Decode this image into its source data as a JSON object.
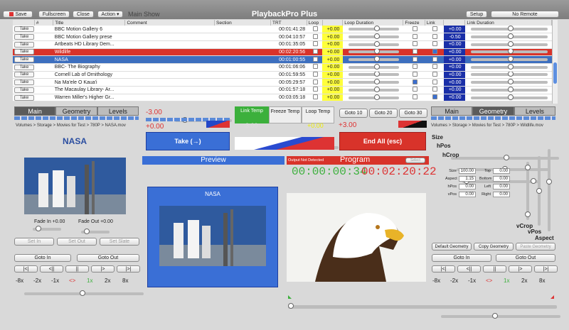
{
  "toolbar": {
    "save": "Save",
    "fullscreen": "Fullscreen",
    "close": "Close",
    "action": "Action",
    "show": "Main Show",
    "app": "PlaybackPro Plus",
    "setup": "Setup",
    "remote": "No Remote"
  },
  "table": {
    "headers": [
      "",
      "#",
      "Title",
      "Comment",
      "Section",
      "TRT",
      "Loop",
      "",
      "Loop Duration",
      "Freeze",
      "Link",
      "",
      "Link Duration"
    ],
    "take": "Take",
    "rows": [
      {
        "title": "BBC Motion Gallery 6",
        "trt": "00:01:41:28",
        "loop": "+0.00",
        "freeze": false,
        "link": false,
        "link_dur": "+0.00",
        "state": ""
      },
      {
        "title": "BBC Motion Gallery prese",
        "trt": "00:04:10:57",
        "loop": "+0.00",
        "freeze": false,
        "link": false,
        "link_dur": "-0.50",
        "state": ""
      },
      {
        "title": "Artbeats HD Library Dem...",
        "trt": "00:01:35:05",
        "loop": "+0.00",
        "freeze": false,
        "link": false,
        "link_dur": "+0.00",
        "state": ""
      },
      {
        "title": "Wildlife",
        "trt": "00:02:20:56",
        "loop": "+0.00",
        "freeze": false,
        "link": true,
        "link_dur": "+0.00",
        "state": "red"
      },
      {
        "title": "NASA",
        "trt": "00:01:00:55",
        "loop": "+0.00",
        "freeze": false,
        "link": false,
        "link_dur": "+0.00",
        "state": "blue"
      },
      {
        "title": "BBC- The Biography",
        "trt": "00:01:06:06",
        "loop": "+0.00",
        "freeze": false,
        "link": false,
        "link_dur": "+0.00",
        "state": ""
      },
      {
        "title": "Cornell Lab of Ornithology",
        "trt": "00:01:59:55",
        "loop": "+0.00",
        "freeze": false,
        "link": false,
        "link_dur": "+0.00",
        "state": ""
      },
      {
        "title": "Na Ma'ele O Kaua'i",
        "trt": "00:05:29:57",
        "loop": "+0.00",
        "freeze": true,
        "link": false,
        "link_dur": "+0.00",
        "state": ""
      },
      {
        "title": "The Macaulay Library- Ar...",
        "trt": "00:01:57:18",
        "loop": "+0.00",
        "freeze": false,
        "link": false,
        "link_dur": "+0.00",
        "state": ""
      },
      {
        "title": "Warren Miller's Higher Gr...",
        "trt": "00:03:05:18",
        "loop": "+0.00",
        "freeze": false,
        "link": true,
        "link_dur": "+0.00",
        "state": ""
      }
    ]
  },
  "left": {
    "tabs": [
      "Main",
      "Geometry",
      "Levels"
    ],
    "path": "Volumes > Storage > Movies for Test > 780P > NASA.mov",
    "clip": "NASA",
    "fade_in": "Fade In +0.00",
    "fade_out": "Fade Out +0.00",
    "set_in": "Set In",
    "set_out": "Set Out",
    "set_slate": "Set Slate",
    "goto_in": "Goto In",
    "goto_out": "Goto Out",
    "transport": [
      "|<|",
      "<||",
      "||",
      "|>",
      "|>|"
    ],
    "speeds": [
      "-8x",
      "-2x",
      "-1x",
      "<>",
      "1x",
      "2x",
      "8x"
    ]
  },
  "center": {
    "val1": "-3.00",
    "val2": "+0.00",
    "take": "Take (→)",
    "link_temp": "Link Temp",
    "freeze_temp": "Freeze Temp",
    "loop_temp": "Loop Temp",
    "val3": "-3.00",
    "val4": "+0.00",
    "preview": "Preview",
    "preview_clip": "NASA"
  },
  "right": {
    "goto": [
      "Goto 10",
      "Goto 20",
      "Goto 30"
    ],
    "val": "+3.00",
    "endall": "End All (esc)",
    "program": "Program",
    "output": "Output Not Detected",
    "select": "Select",
    "tc1": "00:00:00:34",
    "tc2": "00:02:20:22",
    "tabs": [
      "Main",
      "Geometry",
      "Levels"
    ],
    "path": "Volumes > Storage > Movies for Test > 780P > Wildlife.mov",
    "size": "Size",
    "hpos": "hPos",
    "hcrop": "hCrop",
    "vcrop": "vCrop",
    "vpos": "vPos",
    "aspect": "Aspect",
    "fields": [
      {
        "l": "Size",
        "v": "100.00"
      },
      {
        "l": "Top",
        "v": "0.00"
      },
      {
        "l": "Aspect",
        "v": "1.15"
      },
      {
        "l": "Bottom",
        "v": "0.00"
      },
      {
        "l": "hPos",
        "v": "0.00"
      },
      {
        "l": "Left",
        "v": "0.00"
      },
      {
        "l": "vPos",
        "v": "0.00"
      },
      {
        "l": "Right",
        "v": "0.00"
      }
    ],
    "default_geo": "Default Geometry",
    "copy_geo": "Copy Geometry",
    "paste_geo": "Paste Geometry",
    "goto_in": "Goto In",
    "goto_out": "Goto Out",
    "transport": [
      "|<|",
      "<||",
      "||",
      "|>",
      "|>|"
    ],
    "speeds": [
      "-8x",
      "-2x",
      "-1x",
      "<>",
      "1x",
      "2x",
      "8x"
    ]
  }
}
